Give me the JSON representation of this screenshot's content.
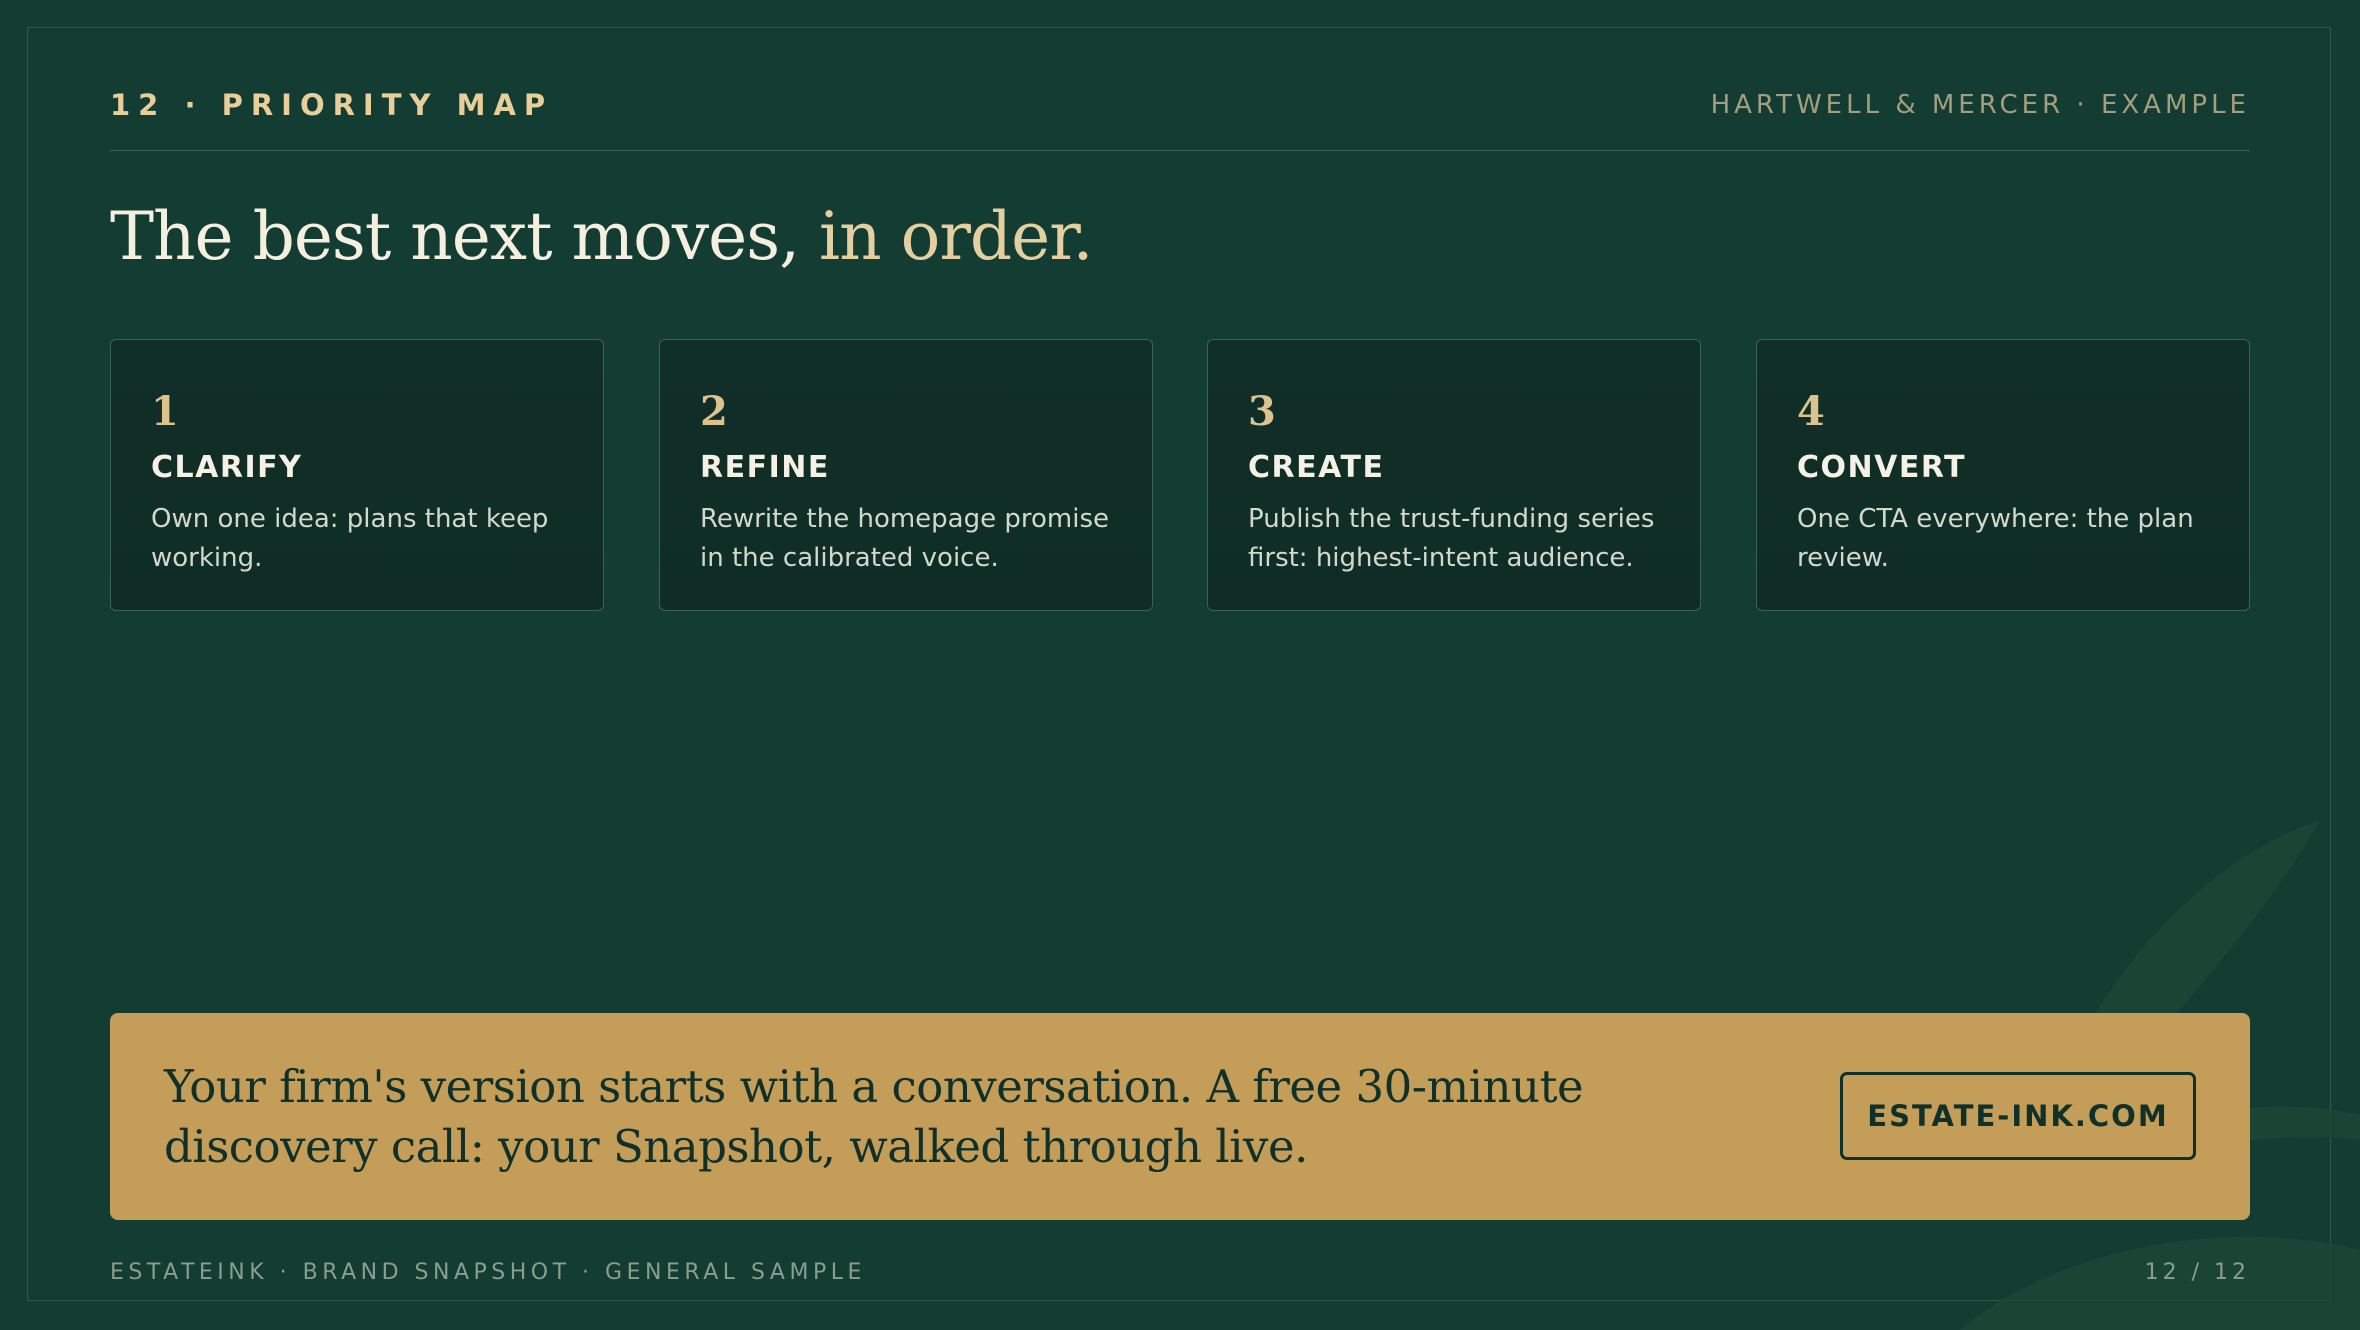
{
  "header": {
    "section_label": "12 · PRIORITY MAP",
    "client_label": "HARTWELL & MERCER · EXAMPLE"
  },
  "headline": {
    "main": "The best next moves, ",
    "accent": "in order."
  },
  "cards": [
    {
      "number": "1",
      "title": "CLARIFY",
      "body": "Own one idea: plans that keep working."
    },
    {
      "number": "2",
      "title": "REFINE",
      "body": "Rewrite the homepage promise in the calibrated voice."
    },
    {
      "number": "3",
      "title": "CREATE",
      "body": "Publish the trust-funding series first: highest-intent audience."
    },
    {
      "number": "4",
      "title": "CONVERT",
      "body": "One CTA everywhere: the plan review."
    }
  ],
  "cta": {
    "text": "Your firm's version starts with a conversation. A free 30-minute discovery call: your Snapshot, walked through live.",
    "button_label": "ESTATE-INK.COM"
  },
  "footer": {
    "left": "ESTATEINK · BRAND SNAPSHOT · GENERAL SAMPLE",
    "right": "12 / 12"
  },
  "colors": {
    "background": "#133c32",
    "accent_gold": "#c49e59",
    "headline_accent": "#e3cfa0"
  },
  "icons": {
    "decoration": "leaf-icon"
  }
}
